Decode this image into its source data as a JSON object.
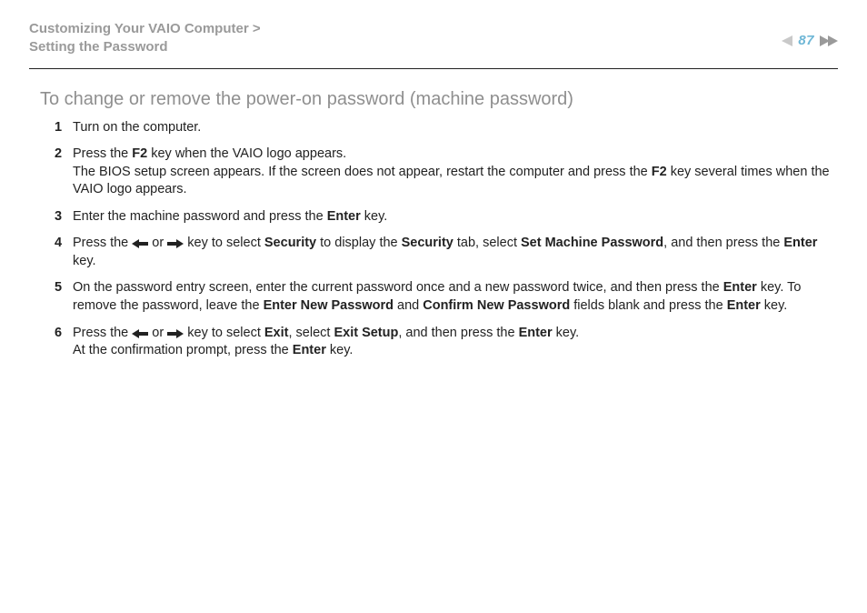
{
  "header": {
    "breadcrumb_line1": "Customizing Your VAIO Computer >",
    "breadcrumb_line2": "Setting the Password",
    "page_number": "87"
  },
  "section_title": "To change or remove the power-on password (machine password)",
  "steps": {
    "s1": "Turn on the computer.",
    "s2a": "Press the ",
    "s2b": "F2",
    "s2c": " key when the VAIO logo appears.",
    "s2d": "The BIOS setup screen appears. If the screen does not appear, restart the computer and press the ",
    "s2e": "F2",
    "s2f": " key several times when the VAIO logo appears.",
    "s3a": "Enter the machine password and press the ",
    "s3b": "Enter",
    "s3c": " key.",
    "s4a": "Press the ",
    "s4b": " or ",
    "s4c": " key to select ",
    "s4d": "Security",
    "s4e": " to display the ",
    "s4f": "Security",
    "s4g": " tab, select ",
    "s4h": "Set Machine Password",
    "s4i": ", and then press the ",
    "s4j": "Enter",
    "s4k": " key.",
    "s5a": "On the password entry screen, enter the current password once and a new password twice, and then press the ",
    "s5b": "Enter",
    "s5c": " key. To remove the password, leave the ",
    "s5d": "Enter New Password",
    "s5e": " and ",
    "s5f": "Confirm New Password",
    "s5g": " fields blank and press the ",
    "s5h": "Enter",
    "s5i": " key.",
    "s6a": "Press the ",
    "s6b": " or ",
    "s6c": " key to select ",
    "s6d": "Exit",
    "s6e": ", select ",
    "s6f": "Exit Setup",
    "s6g": ", and then press the ",
    "s6h": "Enter",
    "s6i": " key.",
    "s6j": "At the confirmation prompt, press the ",
    "s6k": "Enter",
    "s6l": " key."
  }
}
